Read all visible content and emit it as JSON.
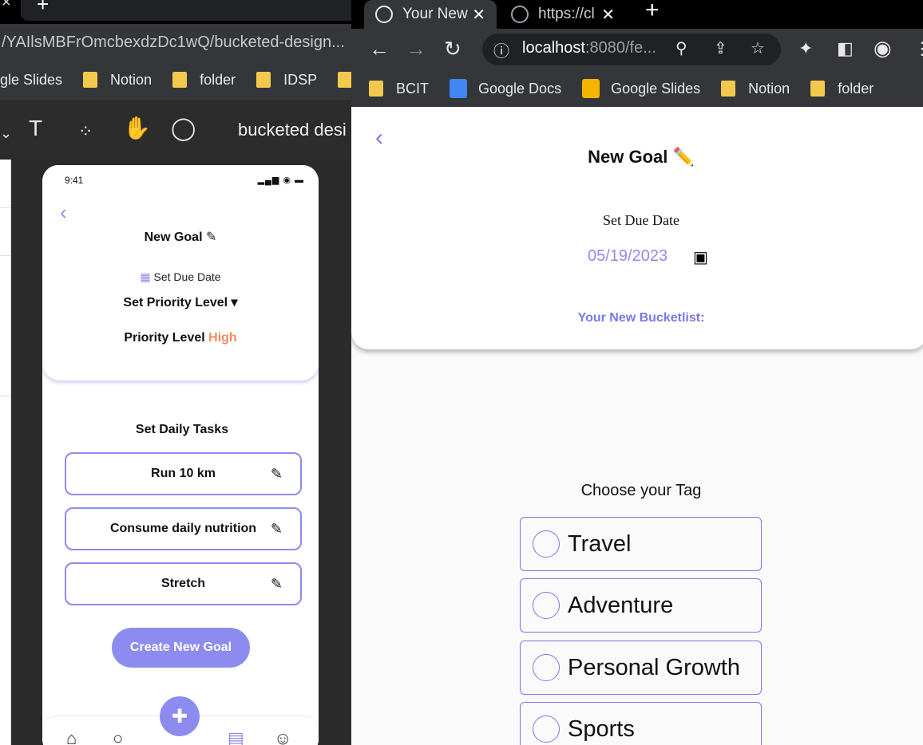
{
  "design_tool": {
    "url_fragment": "/YAIlsMBFrOmcbexdzDc1wQ/bucketed-design...",
    "bookmarks": [
      "gle Slides",
      "Notion",
      "folder",
      "IDSP"
    ],
    "doc_title": "bucketed desi",
    "phone": {
      "time": "9:41",
      "status_icons": "▂▄▆ ◉ ▬",
      "title": "New Goal",
      "due_date_label": "Set Due Date",
      "priority_select": "Set Priority Level ▾",
      "priority_label": "Priority Level",
      "priority_value": "High",
      "tasks_title": "Set Daily Tasks",
      "tasks": [
        "Run 10 km",
        "Consume daily nutrition",
        "Stretch"
      ],
      "create_button": "Create New Goal"
    }
  },
  "browser": {
    "tabs": [
      {
        "title": "Your New"
      },
      {
        "title": "https://cl"
      }
    ],
    "url_host": "localhost",
    "url_rest": ":8080/fe...",
    "bookmarks": [
      "BCIT",
      "Google Docs",
      "Google Slides",
      "Notion",
      "folder"
    ],
    "page": {
      "title": "New Goal",
      "title_emoji": "✏️",
      "due_date_label": "Set Due Date",
      "due_date_value": "05/19/2023",
      "bucketlist_label": "Your New Bucketlist:",
      "tag_prompt": "Choose your Tag",
      "tags": [
        "Travel",
        "Adventure",
        "Personal Growth",
        "Sports"
      ]
    }
  },
  "colors": {
    "accent": "#8e8bf0",
    "priority_high": "#f08a5d"
  }
}
